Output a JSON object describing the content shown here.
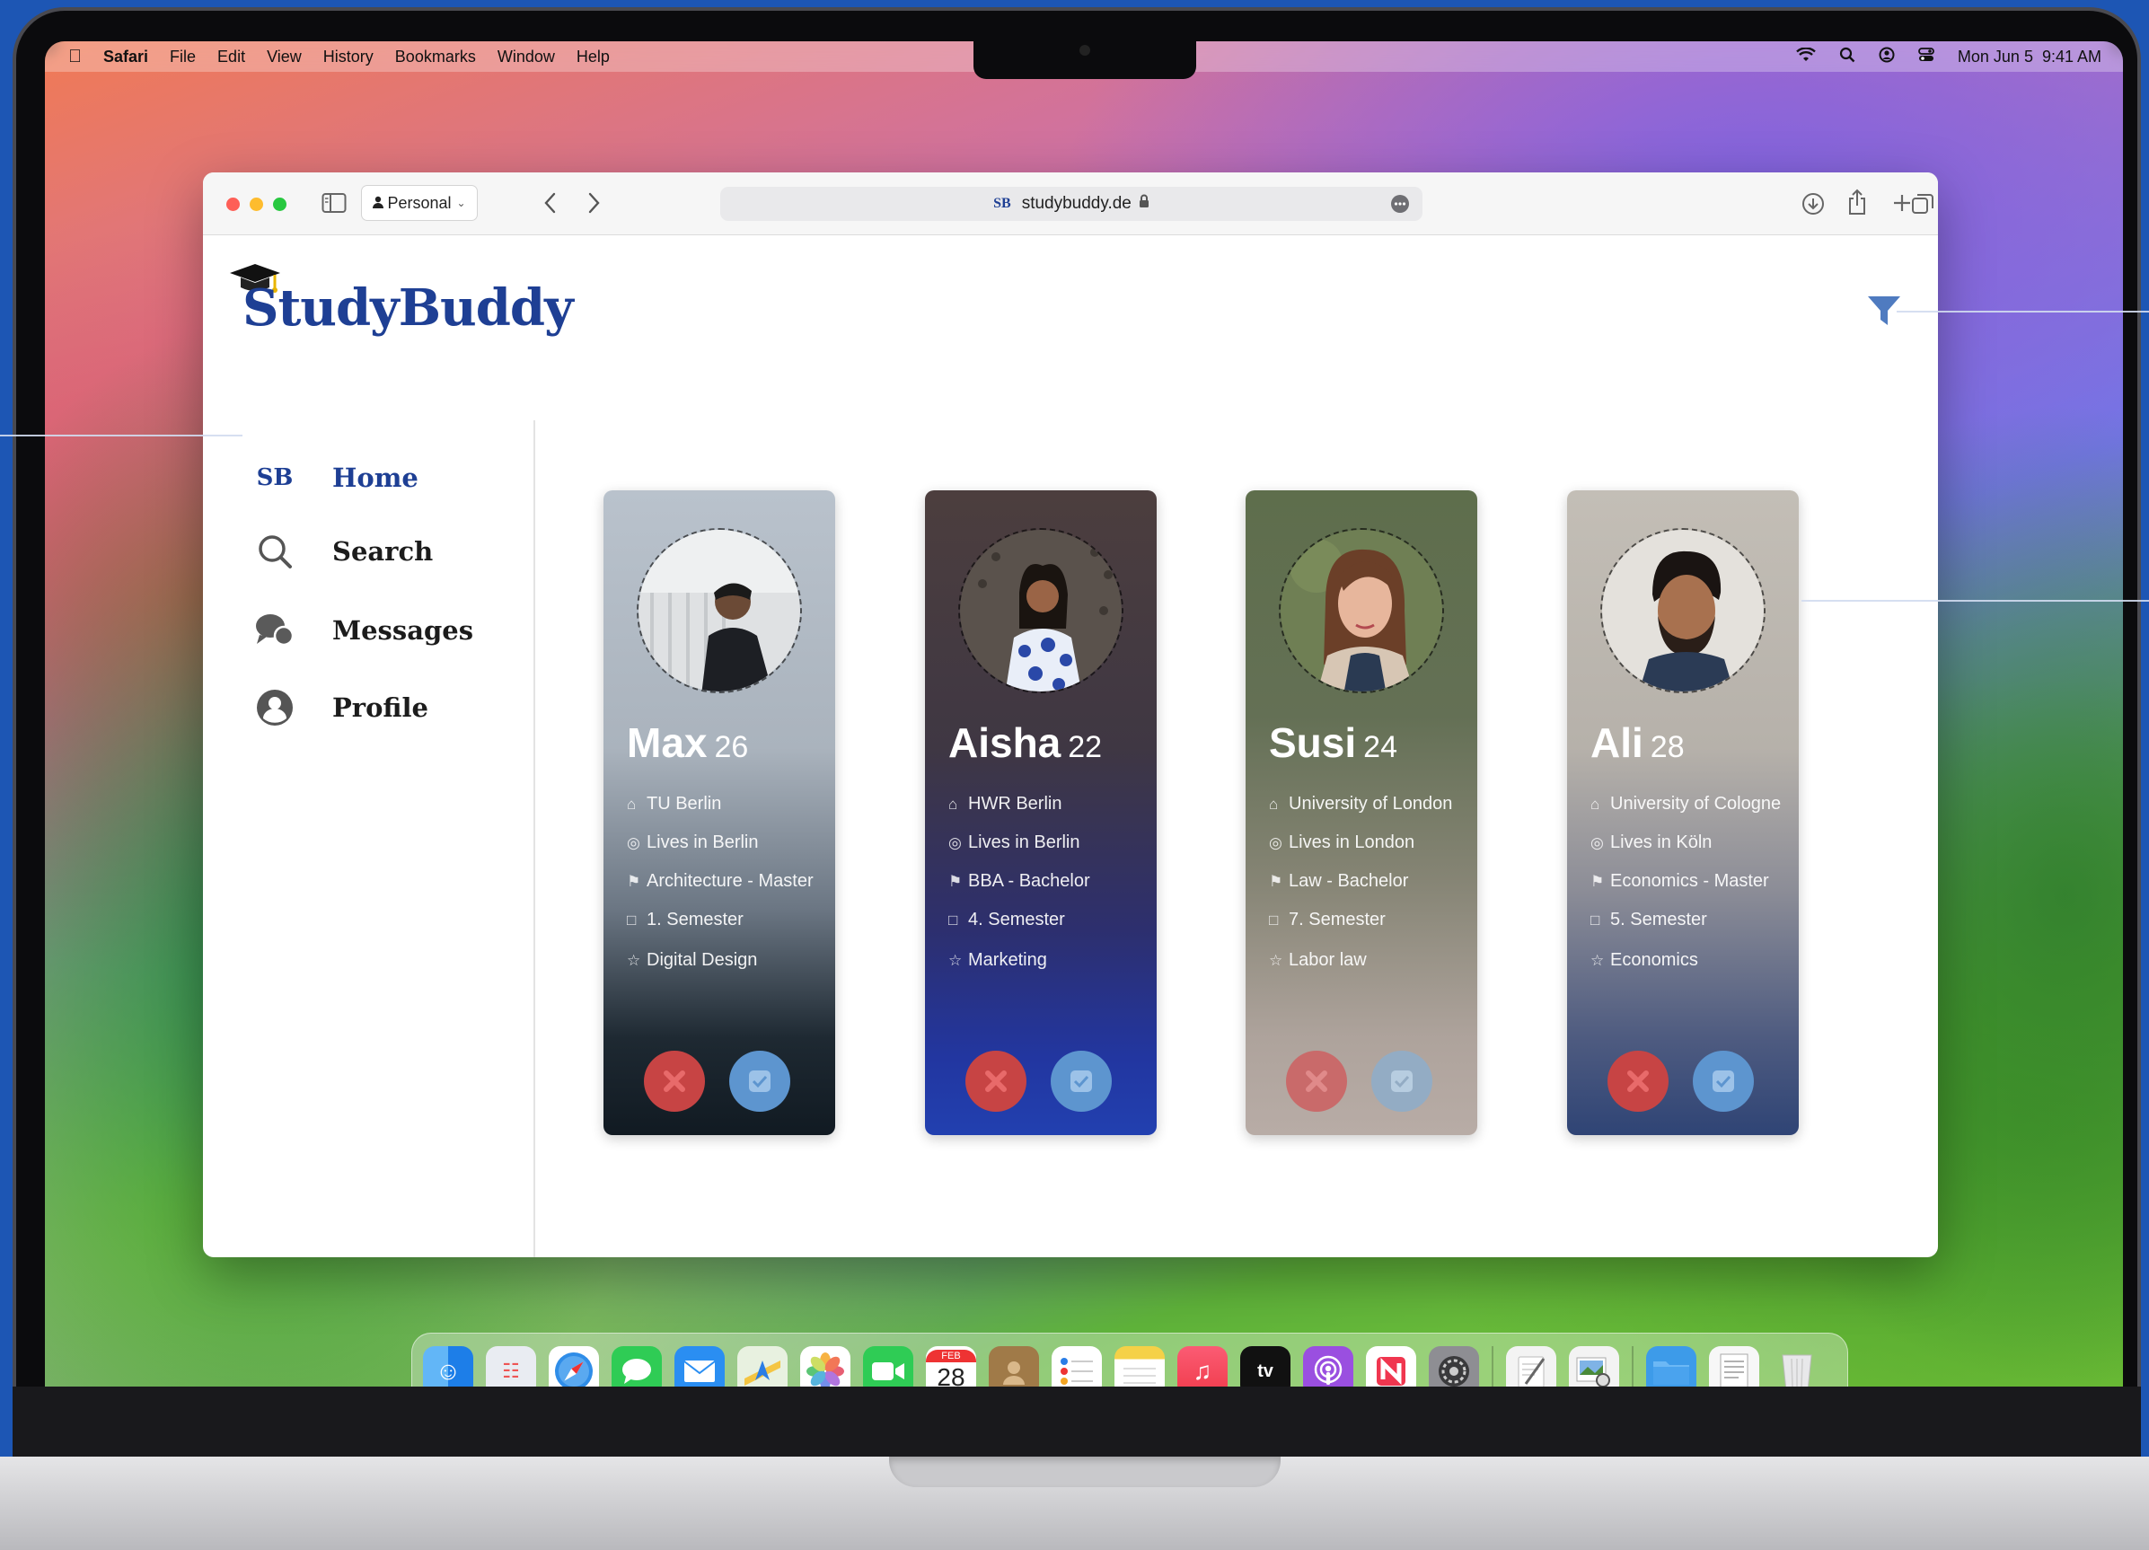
{
  "menubar": {
    "app_name": "Safari",
    "items": [
      "File",
      "Edit",
      "View",
      "History",
      "Bookmarks",
      "Window",
      "Help"
    ],
    "clock": "Mon Jun 5  9:41 AM"
  },
  "browser": {
    "profile": "Personal",
    "url_prefix": "SB",
    "url": "studybuddy.de"
  },
  "site": {
    "logo": "StudyBuddy",
    "nav": [
      {
        "label": "Home",
        "icon": "sb-logo-icon",
        "mark": "SB"
      },
      {
        "label": "Search",
        "icon": "search-icon"
      },
      {
        "label": "Messages",
        "icon": "chat-bubble-icon"
      },
      {
        "label": "Profile",
        "icon": "user-icon"
      }
    ],
    "cards": [
      {
        "name": "Max",
        "age": "26",
        "university": "TU Berlin",
        "location": "Lives in Berlin",
        "program": "Architecture - Master",
        "semester": "1. Semester",
        "interest": "Digital Design"
      },
      {
        "name": "Aisha",
        "age": "22",
        "university": "HWR Berlin",
        "location": "Lives in Berlin",
        "program": "BBA - Bachelor",
        "semester": "4. Semester",
        "interest": "Marketing"
      },
      {
        "name": "Susi",
        "age": "24",
        "university": "University of London",
        "location": "Lives in London",
        "program": "Law - Bachelor",
        "semester": "7. Semester",
        "interest": "Labor law"
      },
      {
        "name": "Ali",
        "age": "28",
        "university": "University of Cologne",
        "location": "Lives in Köln",
        "program": "Economics - Master",
        "semester": "5. Semester",
        "interest": "Economics"
      }
    ]
  },
  "dock": {
    "calendar_month": "FEB",
    "calendar_day": "28",
    "tv_label": "tv"
  },
  "colors": {
    "brand": "#1e3f94",
    "reject": "#c74444",
    "accept": "#5d95cf"
  }
}
